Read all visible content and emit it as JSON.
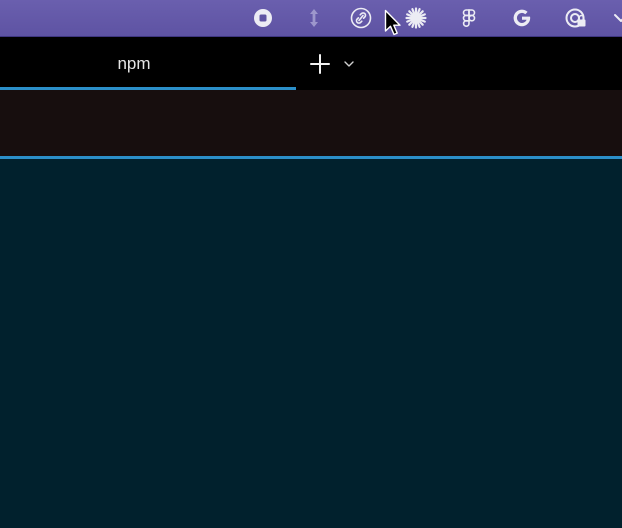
{
  "menubar": {
    "icons": [
      "stop-icon",
      "resize-vertical-icon",
      "link-icon",
      "sparkle-icon",
      "figma-icon",
      "google-icon",
      "privacy-lock-icon",
      "chevron-down-icon"
    ]
  },
  "tabs": [
    {
      "label": "npm",
      "active": true
    }
  ],
  "colors": {
    "menubar": "#5e53a3",
    "tabbar": "#000000",
    "accent": "#2b8fc9",
    "command_area": "#170e0e",
    "terminal": "#01212d"
  }
}
